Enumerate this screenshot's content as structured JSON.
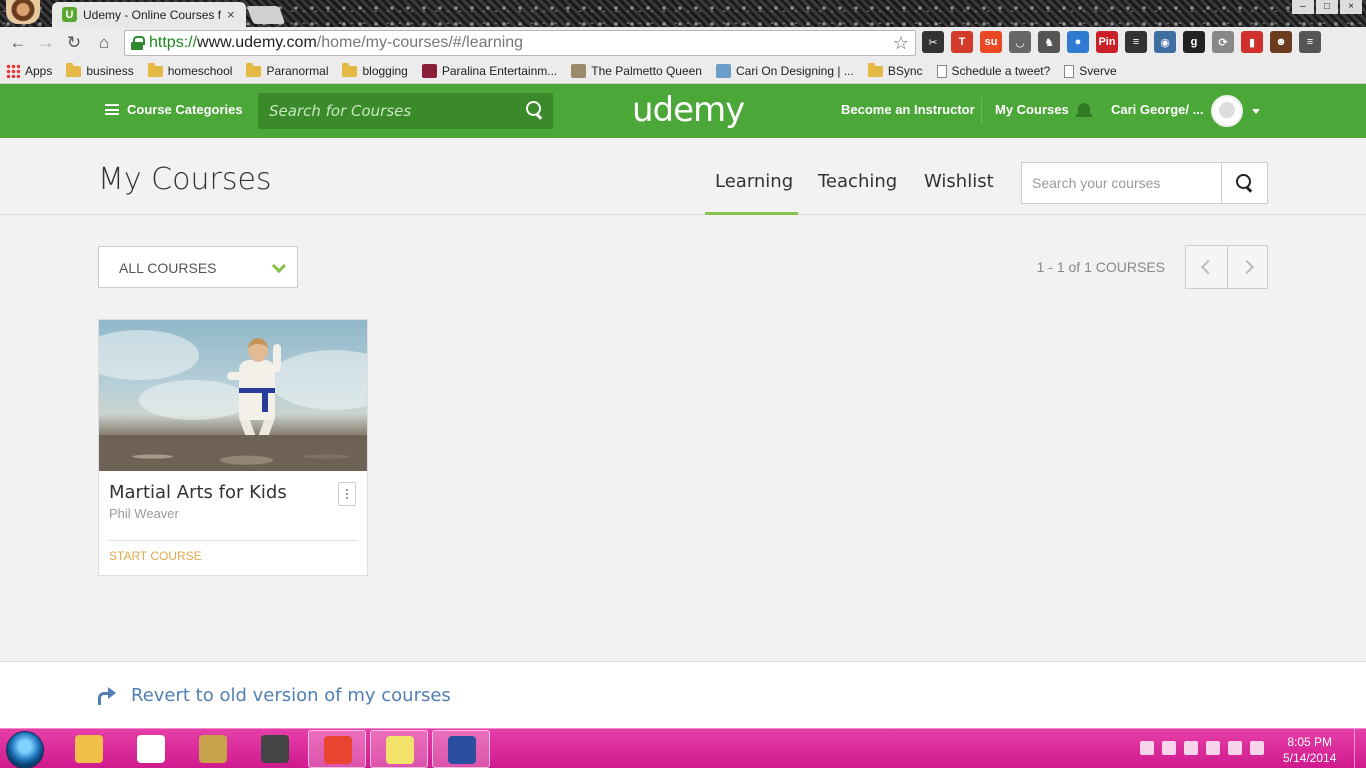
{
  "browser": {
    "tab_title": "Udemy - Online Courses f",
    "tab_favicon_letter": "U",
    "tab_close": "×",
    "url_scheme": "https://",
    "url_host": "www.udemy.com",
    "url_path": "/home/my-courses/#/learning",
    "star": "☆",
    "window_controls": [
      "–",
      "□",
      "×"
    ],
    "nav": {
      "back": "←",
      "forward": "→",
      "reload": "↻",
      "home": "⌂"
    },
    "extensions": [
      {
        "name": "scissors-icon",
        "label": "✂",
        "color": "#333333"
      },
      {
        "name": "tweetdeck-icon",
        "label": "T",
        "color": "#d33a2c"
      },
      {
        "name": "stumbleupon-icon",
        "label": "su",
        "color": "#eb4924"
      },
      {
        "name": "pocket-icon",
        "label": "◡",
        "color": "#666666"
      },
      {
        "name": "evernote-icon",
        "label": "♞",
        "color": "#555555"
      },
      {
        "name": "pushbullet-icon",
        "label": "●",
        "color": "#2e7bd1"
      },
      {
        "name": "pinterest-icon",
        "label": "Pin",
        "color": "#cb2027"
      },
      {
        "name": "buffer-icon",
        "label": "≡",
        "color": "#333333"
      },
      {
        "name": "owl-icon",
        "label": "◉",
        "color": "#3f6ea0"
      },
      {
        "name": "goodreads-icon",
        "label": "g",
        "color": "#222222"
      },
      {
        "name": "sync-icon",
        "label": "⟳",
        "color": "#888888"
      },
      {
        "name": "bookmark-red-icon",
        "label": "▮",
        "color": "#d0312d"
      },
      {
        "name": "avatar-ext-icon",
        "label": "☻",
        "color": "#6b3d1e"
      },
      {
        "name": "chrome-menu-icon",
        "label": "≡",
        "color": "#555555"
      }
    ],
    "bookmarks": [
      {
        "label": "Apps",
        "icon": "apps-icon"
      },
      {
        "label": "business",
        "icon": "folder-icon"
      },
      {
        "label": "homeschool",
        "icon": "folder-icon"
      },
      {
        "label": "Paranormal",
        "icon": "folder-icon"
      },
      {
        "label": "blogging",
        "icon": "folder-icon"
      },
      {
        "label": "Paralina Entertainm...",
        "icon": "site-icon"
      },
      {
        "label": "The Palmetto Queen",
        "icon": "site-icon"
      },
      {
        "label": "Cari On Designing | ...",
        "icon": "site-icon"
      },
      {
        "label": "BSync",
        "icon": "folder-icon"
      },
      {
        "label": "Schedule a tweet?",
        "icon": "page-icon"
      },
      {
        "label": "Sverve",
        "icon": "page-icon"
      }
    ]
  },
  "header": {
    "categories_label": "Course Categories",
    "search_placeholder": "Search for Courses",
    "logo": "udemy",
    "become_instructor": "Become an Instructor",
    "my_courses": "My Courses",
    "user_name": "Cari George/ ...",
    "brand_color": "#4ca739"
  },
  "subheader": {
    "title": "My Courses",
    "tabs": [
      {
        "label": "Learning",
        "active": true
      },
      {
        "label": "Teaching",
        "active": false
      },
      {
        "label": "Wishlist",
        "active": false
      }
    ],
    "search_placeholder": "Search your courses"
  },
  "content": {
    "filter_label": "ALL COURSES",
    "course_count": "1 - 1 of 1 COURSES",
    "courses": [
      {
        "title": "Martial Arts for Kids",
        "instructor": "Phil Weaver",
        "action": "START COURSE"
      }
    ]
  },
  "footer": {
    "revert_link": "Revert to old version of my courses"
  },
  "taskbar": {
    "time": "8:05 PM",
    "date": "5/14/2014",
    "apps": [
      {
        "name": "explorer-icon",
        "color": "#f2c04a",
        "active": false
      },
      {
        "name": "apps-grid-icon",
        "color": "#ffffff",
        "active": false
      },
      {
        "name": "owl-app-icon",
        "color": "#c7a24a",
        "active": false
      },
      {
        "name": "filezilla-icon",
        "color": "#444444",
        "active": false
      },
      {
        "name": "chrome-icon",
        "color": "#e8442f",
        "active": true
      },
      {
        "name": "sticky-notes-icon",
        "color": "#f4e36b",
        "active": true
      },
      {
        "name": "photo-viewer-icon",
        "color": "#2b4ea0",
        "active": true
      }
    ]
  }
}
